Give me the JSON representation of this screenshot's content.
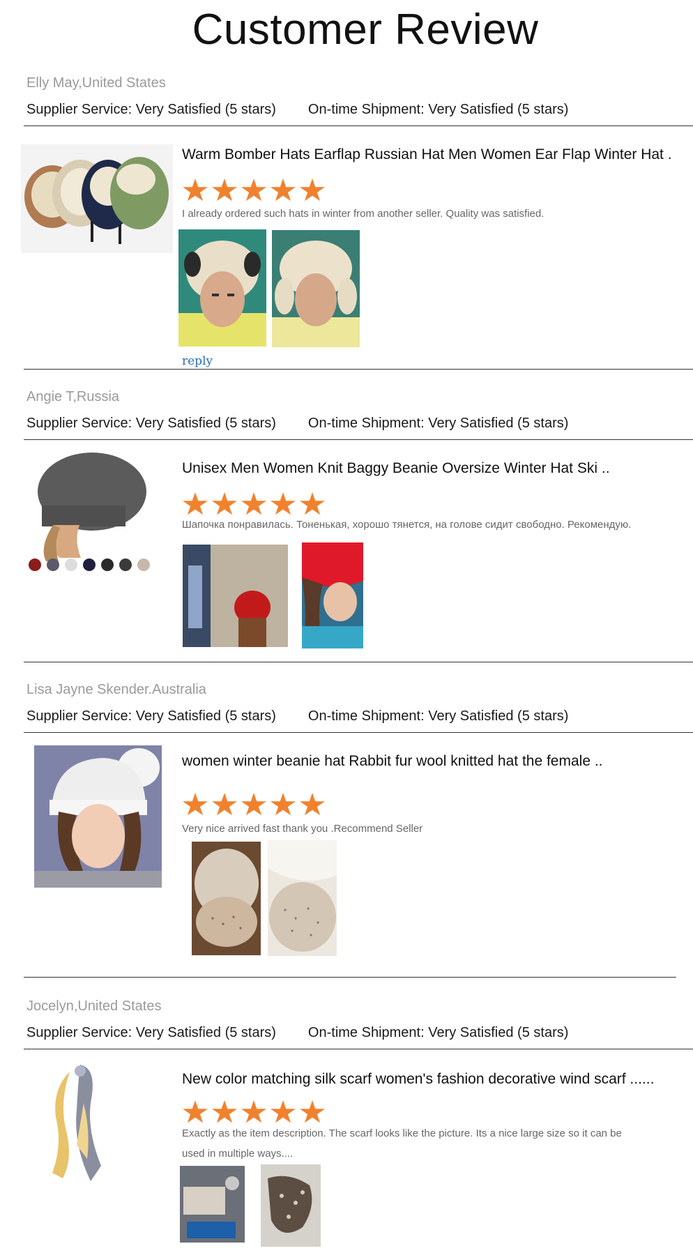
{
  "header": {
    "title": "Customer Review"
  },
  "reviews": [
    {
      "reviewer": "Elly May,United States",
      "supplier_service": "Supplier Service: Very Satisfied (5 stars)",
      "shipment": "On-time Shipment: Very Satisfied (5 stars)",
      "product_title": "Warm Bomber Hats Earflap Russian Hat Men Women Ear Flap Winter Hat .",
      "stars": 5,
      "comment": "I already ordered such hats in winter from another seller. Quality was satisfied.",
      "reply_label": "reply"
    },
    {
      "reviewer": "Angie T,Russia",
      "supplier_service": "Supplier Service: Very Satisfied (5 stars)",
      "shipment": "On-time Shipment: Very Satisfied (5 stars)",
      "product_title": "Unisex Men Women Knit Baggy Beanie Oversize Winter Hat Ski ..",
      "stars": 5,
      "comment": "Шапочка понравилась. Тоненькая, хорошо тянется, на голове сидит свободно. Рекомендую."
    },
    {
      "reviewer": "Lisa Jayne Skender.Australia",
      "supplier_service": "Supplier Service: Very Satisfied (5 stars)",
      "shipment": "On-time Shipment: Very Satisfied (5 stars)",
      "product_title": "women winter beanie hat Rabbit fur wool knitted hat the female ..",
      "stars": 5,
      "comment": "Very nice arrived fast thank you .Recommend Seller"
    },
    {
      "reviewer": "Jocelyn,United States",
      "supplier_service": "Supplier Service: Very Satisfied (5 stars)",
      "shipment": "On-time Shipment: Very Satisfied (5 stars)",
      "product_title": "New color matching silk scarf women's fashion decorative wind scarf ......",
      "stars": 5,
      "comment_line1": "Exactly as the item description. The scarf looks like the picture. Its a nice large size so it can be",
      "comment_line2": "used in multiple ways...."
    }
  ],
  "colors": {
    "star": "#f0822e",
    "muted": "#9a9a9a",
    "link": "#2a6db4"
  }
}
